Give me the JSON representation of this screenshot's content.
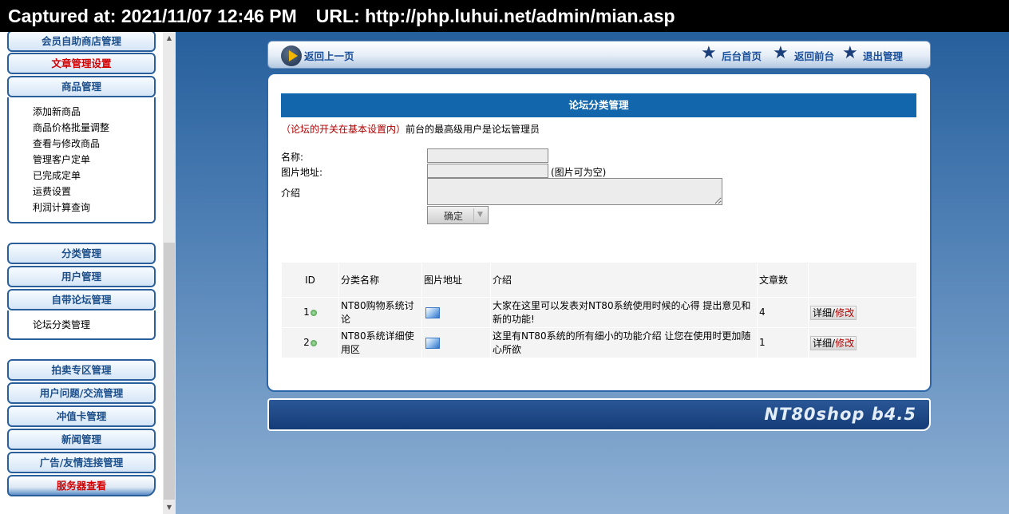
{
  "caption": {
    "captured": "Captured at: 2021/11/07 12:46 PM",
    "url": "URL: http://php.luhui.net/admin/mian.asp"
  },
  "sidebar": {
    "items": [
      {
        "label": "会员自助商店管理",
        "highlight": false
      },
      {
        "label": "文章管理设置",
        "highlight": true
      },
      {
        "label": "商品管理",
        "highlight": false
      },
      {
        "label": "分类管理",
        "highlight": false
      },
      {
        "label": "用户管理",
        "highlight": false
      },
      {
        "label": "自带论坛管理",
        "highlight": false
      },
      {
        "label": "拍卖专区管理",
        "highlight": false
      },
      {
        "label": "用户问题/交流管理",
        "highlight": false
      },
      {
        "label": "冲值卡管理",
        "highlight": false
      },
      {
        "label": "新闻管理",
        "highlight": false
      },
      {
        "label": "广告/友情连接管理",
        "highlight": false
      },
      {
        "label": "服务器查看",
        "highlight": true
      }
    ],
    "product_sub": [
      "添加新商品",
      "商品价格批量调整",
      "查看与修改商品",
      "管理客户定单",
      "已完成定单",
      "运费设置",
      "利润计算查询"
    ],
    "forum_sub": [
      "论坛分类管理"
    ]
  },
  "topnav": {
    "back": "返回上一页",
    "admin_home": "后台首页",
    "front": "返回前台",
    "logout": "退出管理"
  },
  "main": {
    "title": "论坛分类管理",
    "notice_red": "（论坛的开关在基本设置内）",
    "notice_rest": "前台的最高级用户是论坛管理员",
    "form": {
      "name_label": "名称:",
      "image_label": "图片地址:",
      "image_hint": "(图片可为空)",
      "intro_label": "介绍",
      "name_value": "",
      "image_value": "",
      "intro_value": "",
      "submit": "确定"
    },
    "table": {
      "headers": [
        "ID",
        "分类名称",
        "图片地址",
        "介绍",
        "文章数",
        ""
      ],
      "rows": [
        {
          "id": "1",
          "name": "NT80购物系统讨论",
          "intro": "大家在这里可以发表对NT80系统使用时候的心得 提出意见和新的功能!",
          "count": "4",
          "detail": "详细",
          "sep": "/",
          "edit": "修改"
        },
        {
          "id": "2",
          "name": "NT80系统详细使用区",
          "intro": "这里有NT80系统的所有细小的功能介绍 让您在使用时更加随心所欲",
          "count": "1",
          "detail": "详细",
          "sep": "/",
          "edit": "修改"
        }
      ]
    }
  },
  "footer": {
    "brand": "NT80shop b4.5"
  },
  "icons": {
    "back": "play-circle-icon",
    "nav": "star-icon",
    "table_id": "green-dot-icon",
    "table_image": "image-icon",
    "select": "chevron-down-icon"
  },
  "colors": {
    "title_bar": "#1266ac",
    "menu_text": "#1d4f8b",
    "menu_highlight": "#d40000",
    "notice_red": "#b00000"
  }
}
